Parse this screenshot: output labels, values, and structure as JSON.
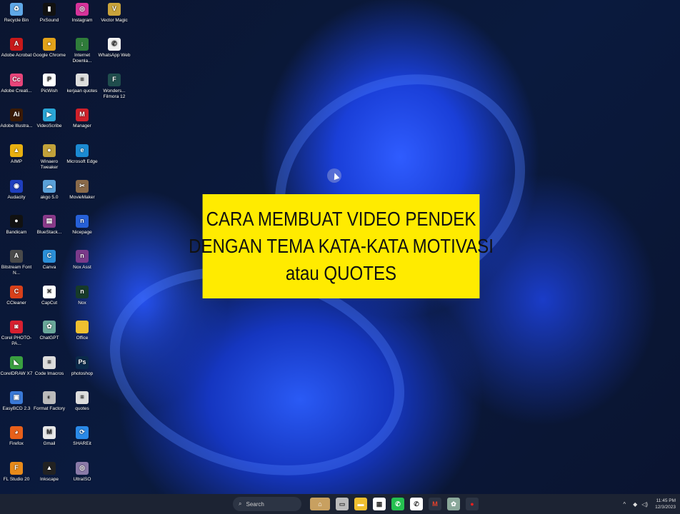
{
  "desktop_icons": [
    {
      "label": "Recycle Bin",
      "icon": "recycle-bin-icon",
      "color": "#5fa8e8",
      "glyph": "♻",
      "col": 0,
      "row": 0
    },
    {
      "label": "PxSound",
      "icon": "pxsound-icon",
      "color": "#111",
      "glyph": "▮",
      "col": 1,
      "row": 0
    },
    {
      "label": "Instagram",
      "icon": "instagram-icon",
      "color": "#d6339a",
      "glyph": "◎",
      "col": 2,
      "row": 0
    },
    {
      "label": "Vector Magic",
      "icon": "vector-magic-icon",
      "color": "#c9a33b",
      "glyph": "V",
      "col": 3,
      "row": 0
    },
    {
      "label": "Adobe Acrobat",
      "icon": "adobe-acrobat-icon",
      "color": "#c8191a",
      "glyph": "A",
      "col": 0,
      "row": 1
    },
    {
      "label": "Google Chrome",
      "icon": "chrome-icon",
      "color": "#e2a21a",
      "glyph": "●",
      "col": 1,
      "row": 1
    },
    {
      "label": "Internet Downla...",
      "icon": "idm-icon",
      "color": "#2f7d3a",
      "glyph": "↓",
      "col": 2,
      "row": 1
    },
    {
      "label": "WhatsApp Web",
      "icon": "whatsapp-icon",
      "color": "#f2f2f2",
      "glyph": "✆",
      "col": 3,
      "row": 1
    },
    {
      "label": "Adobe Creati...",
      "icon": "adobe-cc-icon",
      "color": "#e8457a",
      "glyph": "Cc",
      "col": 0,
      "row": 2
    },
    {
      "label": "PicWish",
      "icon": "picwish-icon",
      "color": "#fff",
      "glyph": "P",
      "col": 1,
      "row": 2
    },
    {
      "label": "kerjaan quotes",
      "icon": "text-file-icon",
      "color": "#ddd",
      "glyph": "≡",
      "col": 2,
      "row": 2
    },
    {
      "label": "Wonders... Filmora 12",
      "icon": "filmora-icon",
      "color": "#1f4d4d",
      "glyph": "F",
      "col": 3,
      "row": 2
    },
    {
      "label": "Adobe Illustra...",
      "icon": "illustrator-icon",
      "color": "#3a1a05",
      "glyph": "Ai",
      "col": 0,
      "row": 3
    },
    {
      "label": "VideoScribe",
      "icon": "videoscribe-icon",
      "color": "#2aa6d6",
      "glyph": "▶",
      "col": 1,
      "row": 3
    },
    {
      "label": "Manager",
      "icon": "manager-icon",
      "color": "#d0202a",
      "glyph": "M",
      "col": 2,
      "row": 3
    },
    {
      "label": "AIMP",
      "icon": "aimp-icon",
      "color": "#e8b010",
      "glyph": "▲",
      "col": 0,
      "row": 4
    },
    {
      "label": "Winaero Tweaker",
      "icon": "winaero-icon",
      "color": "#c2a23a",
      "glyph": "●",
      "col": 1,
      "row": 4
    },
    {
      "label": "Microsoft Edge",
      "icon": "edge-icon",
      "color": "#1b8ad2",
      "glyph": "e",
      "col": 2,
      "row": 4
    },
    {
      "label": "Audacity",
      "icon": "audacity-icon",
      "color": "#1f3fbf",
      "glyph": "◉",
      "col": 0,
      "row": 5
    },
    {
      "label": "akgo 5.0",
      "icon": "akgo-icon",
      "color": "#5aa0d8",
      "glyph": "☁",
      "col": 1,
      "row": 5
    },
    {
      "label": "MovieMaker",
      "icon": "moviemaker-icon",
      "color": "#8a6a4a",
      "glyph": "✂",
      "col": 2,
      "row": 5
    },
    {
      "label": "Bandicam",
      "icon": "bandicam-icon",
      "color": "#111",
      "glyph": "●",
      "col": 0,
      "row": 6
    },
    {
      "label": "BlueStack...",
      "icon": "winrar-icon",
      "color": "#8a3a8a",
      "glyph": "▤",
      "col": 1,
      "row": 6
    },
    {
      "label": "Nicepage",
      "icon": "nicepage-icon",
      "color": "#2660d8",
      "glyph": "n",
      "col": 2,
      "row": 6
    },
    {
      "label": "Bitstream Font N...",
      "icon": "bitstream-icon",
      "color": "#4a4a4a",
      "glyph": "A",
      "col": 0,
      "row": 7
    },
    {
      "label": "Canva",
      "icon": "canva-icon",
      "color": "#2b8fd8",
      "glyph": "C",
      "col": 1,
      "row": 7
    },
    {
      "label": "Nox Asst",
      "icon": "nox-asst-icon",
      "color": "#7a3a8a",
      "glyph": "n",
      "col": 2,
      "row": 7
    },
    {
      "label": "CCleaner",
      "icon": "ccleaner-icon",
      "color": "#d8401a",
      "glyph": "C",
      "col": 0,
      "row": 8
    },
    {
      "label": "CapCut",
      "icon": "capcut-icon",
      "color": "#fff",
      "glyph": "✕",
      "col": 1,
      "row": 8
    },
    {
      "label": "Nox",
      "icon": "nox-icon",
      "color": "#163a2a",
      "glyph": "n",
      "col": 2,
      "row": 8
    },
    {
      "label": "Corel PHOTO-PA...",
      "icon": "corel-photopaint-icon",
      "color": "#d82030",
      "glyph": "◙",
      "col": 0,
      "row": 9
    },
    {
      "label": "ChatGPT",
      "icon": "chatgpt-icon",
      "color": "#6aa89a",
      "glyph": "✿",
      "col": 1,
      "row": 9
    },
    {
      "label": "Office",
      "icon": "folder-icon",
      "color": "#f0c030",
      "glyph": "",
      "col": 2,
      "row": 9
    },
    {
      "label": "CorelDRAW X7",
      "icon": "coreldraw-icon",
      "color": "#3aa040",
      "glyph": "◣",
      "col": 0,
      "row": 10
    },
    {
      "label": "Code Imacros",
      "icon": "text-file-icon",
      "color": "#ddd",
      "glyph": "≡",
      "col": 1,
      "row": 10
    },
    {
      "label": "photoshop",
      "icon": "photoshop-icon",
      "color": "#0a2a4a",
      "glyph": "Ps",
      "col": 2,
      "row": 10
    },
    {
      "label": "EasyBCD 2.3",
      "icon": "easybcd-icon",
      "color": "#3a7ad8",
      "glyph": "▣",
      "col": 0,
      "row": 11
    },
    {
      "label": "Format Factory",
      "icon": "format-factory-icon",
      "color": "#bbb",
      "glyph": "◐",
      "col": 1,
      "row": 11
    },
    {
      "label": "quotes",
      "icon": "text-file-icon",
      "color": "#ddd",
      "glyph": "≡",
      "col": 2,
      "row": 11
    },
    {
      "label": "Firefox",
      "icon": "firefox-icon",
      "color": "#e8601a",
      "glyph": "◕",
      "col": 0,
      "row": 12
    },
    {
      "label": "Gmail",
      "icon": "gmail-icon",
      "color": "#e8e8e8",
      "glyph": "M",
      "col": 1,
      "row": 12
    },
    {
      "label": "SHAREit",
      "icon": "shareit-icon",
      "color": "#2a8ae8",
      "glyph": "⟳",
      "col": 2,
      "row": 12
    },
    {
      "label": "FL Studio 20",
      "icon": "fl-studio-icon",
      "color": "#e88a1a",
      "glyph": "F",
      "col": 0,
      "row": 13
    },
    {
      "label": "Inkscape",
      "icon": "inkscape-icon",
      "color": "#222",
      "glyph": "▲",
      "col": 1,
      "row": 13
    },
    {
      "label": "UltraISO",
      "icon": "ultraiso-icon",
      "color": "#8a7aa8",
      "glyph": "◎",
      "col": 2,
      "row": 13
    }
  ],
  "banner": {
    "line1": "CARA MEMBUAT VIDEO PENDEK",
    "line2": "DENGAN TEMA KATA-KATA MOTIVASI",
    "line3": "atau QUOTES"
  },
  "taskbar": {
    "search_label": "Search",
    "apps": [
      {
        "name": "widgets",
        "icon": "widgets-weather-icon",
        "color": "#c8a060",
        "glyph": "⌂"
      },
      {
        "name": "task-view",
        "icon": "task-view-icon",
        "color": "#bbb",
        "glyph": "▭"
      },
      {
        "name": "file-explorer",
        "icon": "file-explorer-icon",
        "color": "#f0c030",
        "glyph": "▬"
      },
      {
        "name": "microsoft-store",
        "icon": "store-icon",
        "color": "#fff",
        "glyph": "▦"
      },
      {
        "name": "whatsapp",
        "icon": "whatsapp-icon",
        "color": "#25c050",
        "glyph": "✆"
      },
      {
        "name": "whatsapp-web",
        "icon": "whatsapp-icon",
        "color": "#fff",
        "glyph": "✆"
      },
      {
        "name": "gmail",
        "icon": "gmail-icon",
        "color": "#2c3444",
        "glyph": "M"
      },
      {
        "name": "chatgpt",
        "icon": "chatgpt-icon",
        "color": "#8aa89a",
        "glyph": "✿"
      },
      {
        "name": "bandicam",
        "icon": "bandicam-record-icon",
        "color": "#2c3444",
        "glyph": "●"
      }
    ],
    "time": "11:45 PM",
    "date": "12/3/2023"
  }
}
